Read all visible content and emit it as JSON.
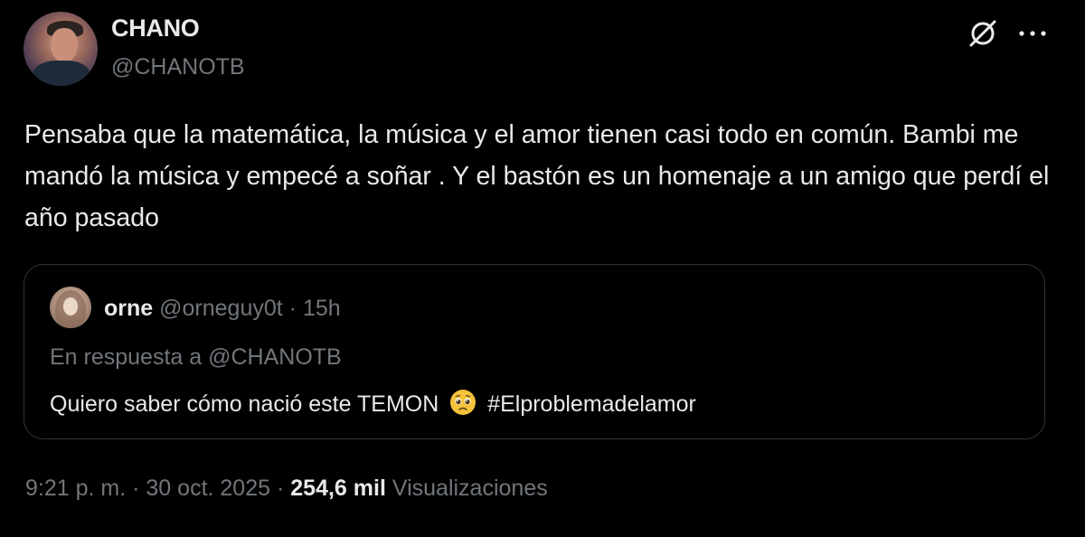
{
  "author": {
    "name": "CHANO",
    "handle": "@CHANOTB"
  },
  "header_icons": {
    "grok": "grok-icon",
    "more": "more-icon"
  },
  "tweet": {
    "text": "Pensaba que la matemática, la música y el amor tienen casi todo en común. Bambi me mandó la música y empecé a soñar . Y el bastón es un homenaje a un amigo que perdí el año pasado"
  },
  "quoted": {
    "name": "orne",
    "handle": "@orneguy0t",
    "separator": "·",
    "time": "15h",
    "reply_to": "En respuesta a @CHANOTB",
    "text_before": "Quiero saber cómo nació este TEMON",
    "emoji": "pleading-face",
    "hashtag": "#Elproblemadelamor"
  },
  "meta": {
    "time": "9:21 p. m.",
    "separator": "·",
    "date": "30 oct. 2025",
    "views_count": "254,6 mil",
    "views_label": "Visualizaciones"
  }
}
